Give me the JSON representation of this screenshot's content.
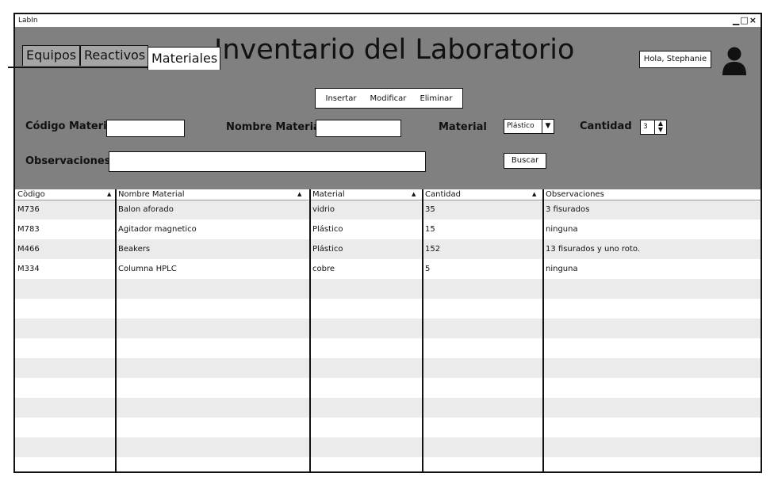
{
  "window": {
    "title": "LabIn",
    "controls": "▁□×"
  },
  "tabs": [
    {
      "label": "Equipos",
      "active": false
    },
    {
      "label": "Reactivos",
      "active": false
    },
    {
      "label": "Materiales",
      "active": true
    }
  ],
  "page_title": "Inventario del Laboratorio",
  "user": {
    "greeting": "Hola, Stephanie",
    "icon": "user-icon"
  },
  "actions": {
    "insert": "Insertar",
    "modify": "Modificar",
    "delete": "Eliminar"
  },
  "form": {
    "code_label": "Código Material",
    "code_value": "",
    "name_label": "Nombre Material",
    "name_value": "",
    "material_label": "Material",
    "material_value": "Plástico",
    "quantity_label": "Cantidad",
    "quantity_value": "3",
    "notes_label": "Observaciones",
    "notes_value": "",
    "search_button": "Buscar"
  },
  "table": {
    "headers": [
      "Còdigo",
      "Nombre Material",
      "Material",
      "Cantidad",
      "Observaciones"
    ],
    "rows": [
      [
        "M736",
        "Balon aforado",
        "vidrio",
        "35",
        "3 fisurados"
      ],
      [
        "M783",
        "Agitador magnetico",
        "Plástico",
        "15",
        "ninguna"
      ],
      [
        "M466",
        "Beakers",
        "Plástico",
        "152",
        "13 fisurados y uno roto."
      ],
      [
        "M334",
        "Columna HPLC",
        "cobre",
        "5",
        "ninguna"
      ]
    ]
  }
}
